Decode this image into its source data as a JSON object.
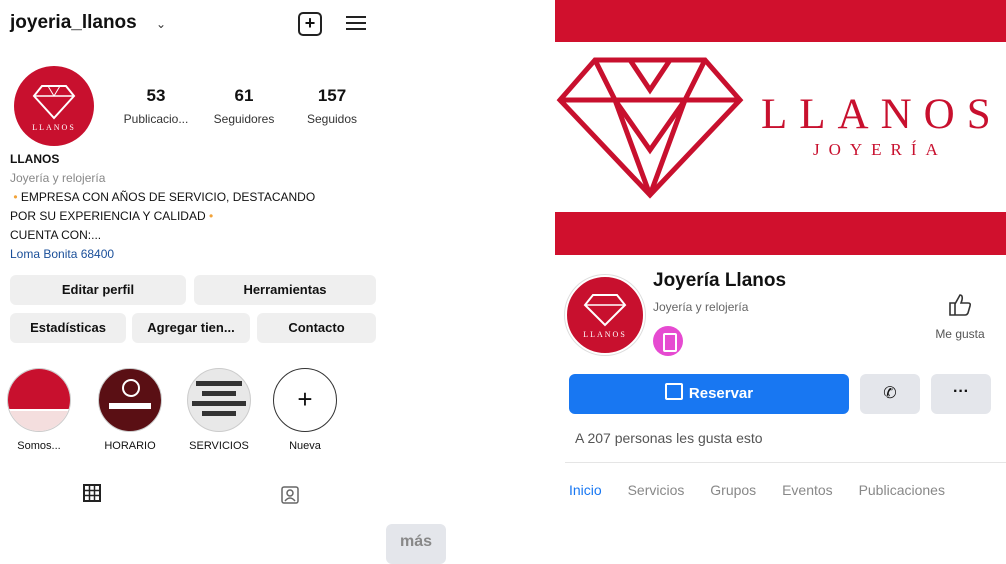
{
  "instagram": {
    "username": "joyeria_llanos",
    "stats": [
      {
        "value": "53",
        "label": "Publicacio..."
      },
      {
        "value": "61",
        "label": "Seguidores"
      },
      {
        "value": "157",
        "label": "Seguidos"
      }
    ],
    "avatar_text": "LLANOS",
    "bio": {
      "name": "LLANOS",
      "category": "Joyería y relojería",
      "line1": "EMPRESA CON AÑOS DE SERVICIO, DESTACANDO",
      "line2": "POR SU EXPERIENCIA Y CALIDAD",
      "line3": "CUENTA CON:...",
      "more": "más",
      "location": "Loma Bonita 68400"
    },
    "buttons": {
      "edit": "Editar perfil",
      "tools": "Herramientas",
      "stats": "Estadísticas",
      "add_store": "Agregar tien...",
      "contact": "Contacto"
    },
    "highlights": [
      {
        "label": "Somos..."
      },
      {
        "label": "HORARIO"
      },
      {
        "label": "SERVICIOS"
      },
      {
        "label": "Nueva"
      }
    ]
  },
  "facebook": {
    "cover_title": "LLANOS",
    "cover_subtitle": "JOYERÍA",
    "page_name": "Joyería Llanos",
    "category": "Joyería y relojería",
    "avatar_text": "LLANOS",
    "like_label": "Me gusta",
    "reserve_label": "Reservar",
    "more_label": "···",
    "likes_text": "A 207 personas les gusta esto",
    "tabs": [
      "Inicio",
      "Servicios",
      "Grupos",
      "Eventos",
      "Publicaciones"
    ]
  },
  "colors": {
    "brand_red": "#c8102e",
    "fb_blue": "#1877f2"
  }
}
